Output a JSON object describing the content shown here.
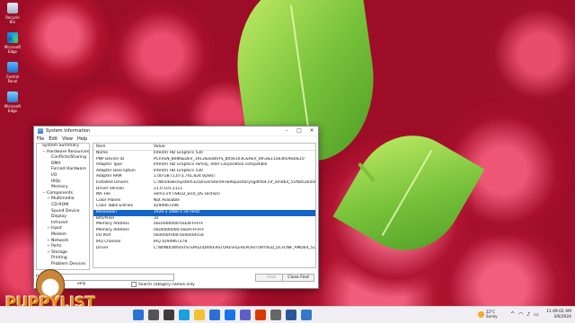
{
  "desktop": {
    "icons": [
      {
        "label": "Recycle Bin",
        "icon": "recycle-bin-icon"
      },
      {
        "label": "Microsoft Edge",
        "icon": "edge-icon"
      },
      {
        "label": "Control Panel",
        "icon": "control-panel-icon"
      },
      {
        "label": "Microsoft Edge",
        "icon": "this-pc-icon"
      }
    ]
  },
  "window": {
    "title": "System Information",
    "menu": [
      "File",
      "Edit",
      "View",
      "Help"
    ],
    "tree": [
      {
        "label": "System Summary",
        "indent": 0,
        "expander": ""
      },
      {
        "label": "Hardware Resources",
        "indent": 1,
        "expander": "−"
      },
      {
        "label": "Conflicts/Sharing",
        "indent": 2,
        "expander": ""
      },
      {
        "label": "DMA",
        "indent": 2,
        "expander": ""
      },
      {
        "label": "Forced Hardware",
        "indent": 2,
        "expander": ""
      },
      {
        "label": "I/O",
        "indent": 2,
        "expander": ""
      },
      {
        "label": "IRQs",
        "indent": 2,
        "expander": ""
      },
      {
        "label": "Memory",
        "indent": 2,
        "expander": ""
      },
      {
        "label": "Components",
        "indent": 1,
        "expander": "−"
      },
      {
        "label": "Multimedia",
        "indent": 2,
        "expander": "+"
      },
      {
        "label": "CD-ROM",
        "indent": 2,
        "expander": ""
      },
      {
        "label": "Sound Device",
        "indent": 2,
        "expander": ""
      },
      {
        "label": "Display",
        "indent": 2,
        "expander": ""
      },
      {
        "label": "Infrared",
        "indent": 2,
        "expander": ""
      },
      {
        "label": "Input",
        "indent": 2,
        "expander": "+"
      },
      {
        "label": "Modem",
        "indent": 2,
        "expander": ""
      },
      {
        "label": "Network",
        "indent": 2,
        "expander": "+"
      },
      {
        "label": "Ports",
        "indent": 2,
        "expander": "+"
      },
      {
        "label": "Storage",
        "indent": 2,
        "expander": "+"
      },
      {
        "label": "Printing",
        "indent": 2,
        "expander": ""
      },
      {
        "label": "Problem Devices",
        "indent": 2,
        "expander": ""
      }
    ],
    "columns": [
      "Item",
      "Value"
    ],
    "rows": [
      {
        "item": "Name",
        "value": "Intel(R) HD Graphics 530"
      },
      {
        "item": "PNP Device ID",
        "value": "PCI\\VEN_8086&DEV_1912&SUBSYS_8056103C&REV_06\\3&11583659&0&10"
      },
      {
        "item": "Adapter Type",
        "value": "Intel(R) HD Graphics Family, Intel Corporation compatible"
      },
      {
        "item": "Adapter Description",
        "value": "Intel(R) HD Graphics 530"
      },
      {
        "item": "Adapter RAM",
        "value": "1.00 GB (1,073,741,824 bytes)"
      },
      {
        "item": "Installed Drivers",
        "value": "C:\\Windows\\System32\\DriverStore\\FileRepository\\igdlh64.inf_amd64_51f6853050e3a5..."
      },
      {
        "item": "Driver Version",
        "value": "21.0.101.2111"
      },
      {
        "item": "INF File",
        "value": "oem3.inf (iSKLD_w10_DS section)"
      },
      {
        "item": "Color Planes",
        "value": "Not Available"
      },
      {
        "item": "Color Table Entries",
        "value": "4294967296"
      },
      {
        "item": "Resolution",
        "value": "1920 x 1080 x 59 hertz",
        "selected": true
      },
      {
        "item": "Bits/Pixel",
        "value": "32"
      },
      {
        "item": "Memory Address",
        "value": "0xE0000000-0xE0FFFFFF"
      },
      {
        "item": "Memory Address",
        "value": "0xD0000000-0xDFFFFFFF"
      },
      {
        "item": "I/O Port",
        "value": "0x0000F000-0x0000F03F"
      },
      {
        "item": "IRQ Channel",
        "value": "IRQ 4294967278"
      },
      {
        "item": "Driver",
        "value": "C:\\WINDOWS\\SYSTEM32\\DRIVERSTORE\\FILEREPOSITORY\\IGD_DCH.INF_AMD64_51F6853..."
      }
    ],
    "find": {
      "label": "Find",
      "value": "",
      "find_button": "Find",
      "close_button": "Close Find",
      "opt_selected": "only",
      "opt_category": "Search category names only"
    }
  },
  "watermark": {
    "text": "PUPPYLIST"
  },
  "taskbar": {
    "apps": [
      "start-icon",
      "search-icon",
      "task-view-icon",
      "edge-icon",
      "explorer-icon",
      "store-icon",
      "mail-icon",
      "teams-icon",
      "office-icon",
      "settings-icon",
      "word-icon",
      "sysinfo-icon"
    ],
    "weather": {
      "temp": "22°C",
      "condition": "Sunny"
    },
    "time": "11:49:02 AM",
    "date": "3/6/2024"
  },
  "colors": {
    "selection": "#1463c7",
    "accent": "#f28a1a"
  }
}
